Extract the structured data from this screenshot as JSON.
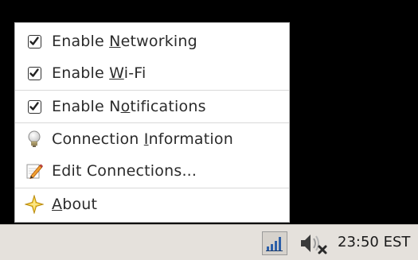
{
  "menu": {
    "items": [
      {
        "type": "check",
        "checked": true,
        "pre": "Enable ",
        "mn": "N",
        "post": "etworking"
      },
      {
        "type": "check",
        "checked": true,
        "pre": "Enable ",
        "mn": "W",
        "post": "i-Fi"
      },
      {
        "type": "check",
        "checked": true,
        "pre": "Enable N",
        "mn": "o",
        "post": "tifications"
      },
      {
        "type": "icon",
        "icon": "lightbulb-icon",
        "pre": "Connection ",
        "mn": "I",
        "post": "nformation"
      },
      {
        "type": "icon",
        "icon": "edit-pencil-icon",
        "pre": "Edit Connections...",
        "mn": "",
        "post": ""
      },
      {
        "type": "icon",
        "icon": "star-icon",
        "pre": "",
        "mn": "A",
        "post": "bout"
      }
    ]
  },
  "taskbar": {
    "network_icon": "network-signal-icon",
    "volume_icon": "volume-muted-icon",
    "clock": "23:50 EST"
  },
  "colors": {
    "background": "#000000",
    "menu_background": "#ffffff",
    "taskbar": "#e5e1dc",
    "signal_bar": "#2c5fa8"
  }
}
